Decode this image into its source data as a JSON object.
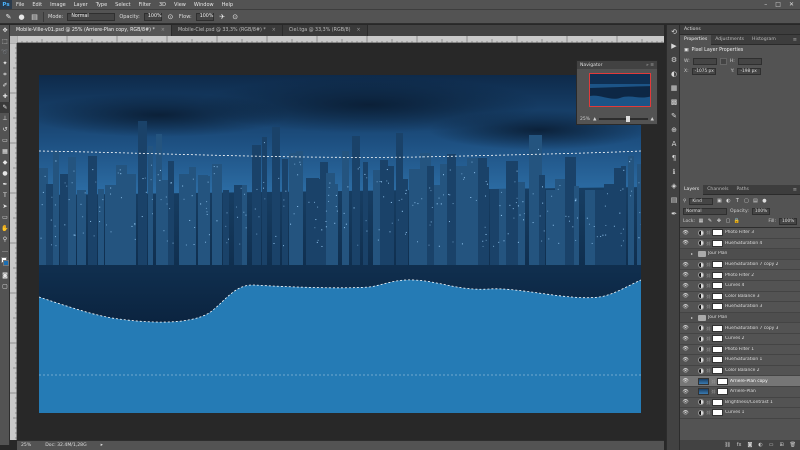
{
  "app": {
    "logo": "Ps",
    "menu": [
      "File",
      "Edit",
      "Image",
      "Layer",
      "Type",
      "Select",
      "Filter",
      "3D",
      "View",
      "Window",
      "Help"
    ],
    "window_controls": [
      "–",
      "□",
      "✕"
    ]
  },
  "options_bar": {
    "mode_label": "Mode:",
    "mode_value": "Normal",
    "opacity_label": "Opacity:",
    "opacity_value": "100%",
    "flow_label": "Flow:",
    "flow_value": "100%"
  },
  "tabs": [
    {
      "label": "Mobile-Ville-v01.psd @ 25% (Arriere-Plan copy, RGB/8#) *",
      "active": true
    },
    {
      "label": "Mobile-Ciel.psd @ 33,3% (RGB/8#) *",
      "active": false
    },
    {
      "label": "Ciel.tga @ 33,3% (RGB/8)",
      "active": false
    }
  ],
  "navigator": {
    "title": "Navigator",
    "zoom": "25%"
  },
  "status_bar": {
    "zoom": "25%",
    "doc_info": "Doc: 32.4M/1,28G"
  },
  "panels": {
    "actions_label": "Actions",
    "prop_tabs": [
      "Properties",
      "Adjustments",
      "Histogram"
    ],
    "props_title": "Pixel Layer Properties",
    "w_label": "W:",
    "h_label": "H:",
    "x_label": "X:",
    "y_label": "Y:",
    "x_value": "-1075 px",
    "y_value": "-198 px",
    "layers_tabs": [
      "Layers",
      "Channels",
      "Paths"
    ],
    "kind_label": "Kind",
    "blend_mode": "Normal",
    "opacity_label": "Opacity:",
    "opacity_value": "100%",
    "lock_label": "Lock:",
    "fill_label": "Fill:",
    "fill_value": "100%"
  },
  "layers": [
    {
      "name": "Photo Filter 3",
      "type": "adj",
      "visible": true
    },
    {
      "name": "Hue/Saturation 4",
      "type": "adj",
      "visible": true
    },
    {
      "name": "Jour Plan",
      "type": "group",
      "visible": false
    },
    {
      "name": "Hue/Saturation 7 copy 2",
      "type": "adj",
      "visible": true
    },
    {
      "name": "Photo Filter 2",
      "type": "adj",
      "visible": true
    },
    {
      "name": "Curves 4",
      "type": "adj",
      "visible": true
    },
    {
      "name": "Color Balance 3",
      "type": "adj",
      "visible": true
    },
    {
      "name": "Hue/Saturation 3",
      "type": "adj",
      "visible": true
    },
    {
      "name": "Jour Plan",
      "type": "group",
      "visible": false
    },
    {
      "name": "Hue/Saturation 7 copy 3",
      "type": "adj",
      "visible": true
    },
    {
      "name": "Curves 2",
      "type": "adj",
      "visible": true
    },
    {
      "name": "Photo Filter 1",
      "type": "adj",
      "visible": true
    },
    {
      "name": "Hue/Saturation 1",
      "type": "adj",
      "visible": true
    },
    {
      "name": "Color Balance 2",
      "type": "adj",
      "visible": true
    },
    {
      "name": "Arriere-Plan copy",
      "type": "pixel",
      "visible": true,
      "selected": true
    },
    {
      "name": "Arriere-Plan",
      "type": "pixel",
      "visible": true
    },
    {
      "name": "Brightness/Contrast 1",
      "type": "adj",
      "visible": true
    },
    {
      "name": "Curves 1",
      "type": "adj",
      "visible": true
    }
  ],
  "icons": {
    "accent": "#257bb5",
    "selection": "#ffffff",
    "nav_frame": "#e23a3a"
  }
}
